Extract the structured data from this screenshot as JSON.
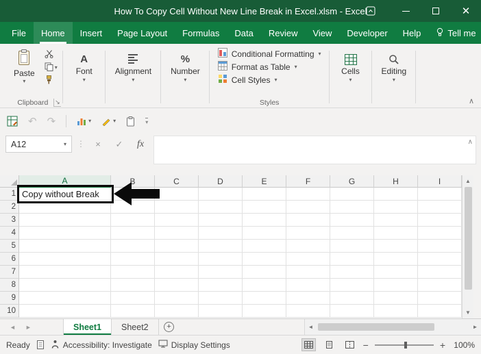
{
  "title_bar": {
    "title": "How To Copy Cell Without New Line Break in Excel.xlsm  -  Excel"
  },
  "menu": {
    "tabs": [
      {
        "label": "File"
      },
      {
        "label": "Home",
        "active": true
      },
      {
        "label": "Insert"
      },
      {
        "label": "Page Layout"
      },
      {
        "label": "Formulas"
      },
      {
        "label": "Data"
      },
      {
        "label": "Review"
      },
      {
        "label": "View"
      },
      {
        "label": "Developer"
      },
      {
        "label": "Help"
      }
    ],
    "tell_me": "Tell me"
  },
  "ribbon": {
    "paste": "Paste",
    "font": "Font",
    "alignment": "Alignment",
    "number": "Number",
    "conditional_formatting": "Conditional Formatting",
    "format_as_table": "Format as Table",
    "cell_styles": "Cell Styles",
    "cells": "Cells",
    "editing": "Editing",
    "groups": {
      "clipboard": "Clipboard",
      "styles": "Styles"
    }
  },
  "formula_bar": {
    "name_box": "A12",
    "cancel": "×",
    "enter": "✓",
    "fx": "fx",
    "value": ""
  },
  "grid": {
    "columns": [
      "A",
      "B",
      "C",
      "D",
      "E",
      "F",
      "G",
      "H",
      "I"
    ],
    "rows": [
      "1",
      "2",
      "3",
      "4",
      "5",
      "6",
      "7",
      "8",
      "9",
      "10"
    ],
    "cells": {
      "A1": "Copy without Break"
    },
    "selected_column": "A"
  },
  "sheet_tabs": {
    "tabs": [
      {
        "label": "Sheet1",
        "active": true
      },
      {
        "label": "Sheet2",
        "active": false
      }
    ],
    "add_label": "+"
  },
  "status_bar": {
    "mode": "Ready",
    "accessibility": "Accessibility: Investigate",
    "display_settings": "Display Settings",
    "zoom_out": "−",
    "zoom_in": "+",
    "zoom_level": "100%"
  },
  "icons": {
    "dropdown": "▾",
    "up_scroll": "▲",
    "down_scroll": "▼",
    "left_scroll": "◄",
    "right_scroll": "►",
    "collapse": "∧",
    "separator": "⋮",
    "dialog_launcher": "↘",
    "undo": "↶",
    "redo": "↷",
    "percent": "%",
    "font_letter": "A"
  },
  "colors": {
    "title_green": "#185C37",
    "ribbon_green": "#107C41",
    "accent_green": "#107C41",
    "annotation_black": "#0a0a0a"
  }
}
